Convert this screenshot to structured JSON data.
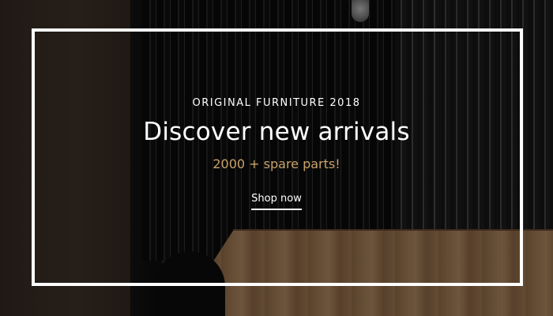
{
  "hero": {
    "eyebrow": "ORIGINAL FURNITURE 2018",
    "headline": "Discover new arrivals",
    "subline": "2000 + spare parts!",
    "cta_label": "Shop now"
  },
  "colors": {
    "accent_gold": "#c9a46a",
    "text": "#ffffff",
    "frame": "#ffffff"
  }
}
